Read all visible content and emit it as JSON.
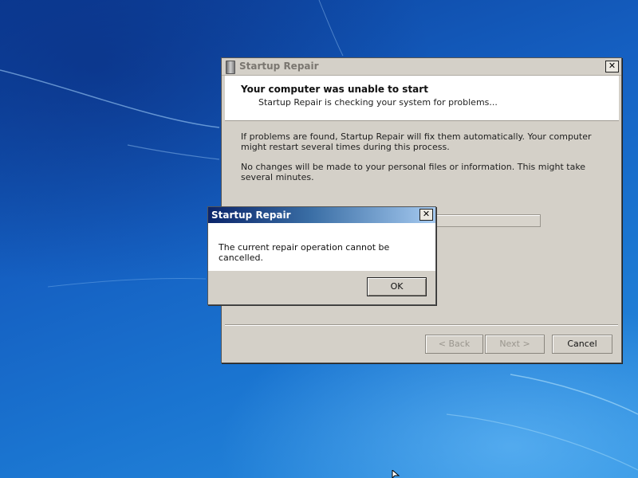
{
  "wizard": {
    "title": "Startup Repair",
    "close": "✕",
    "header_title": "Your computer was unable to start",
    "header_subtitle": "Startup Repair is checking your system for problems...",
    "paragraph1": "If problems are found, Startup Repair will fix them automatically. Your computer might restart several times during this process.",
    "paragraph2": "No changes will be made to your personal files or information. This might take several minutes.",
    "buttons": {
      "back": "< Back",
      "next": "Next >",
      "cancel": "Cancel"
    }
  },
  "dialog": {
    "title": "Startup Repair",
    "close": "✕",
    "message": "The current repair operation cannot be cancelled.",
    "ok": "OK"
  },
  "icons": {
    "wizard_icon": "startup-repair-icon",
    "close": "close-icon",
    "cursor": "mouse-cursor-icon"
  }
}
